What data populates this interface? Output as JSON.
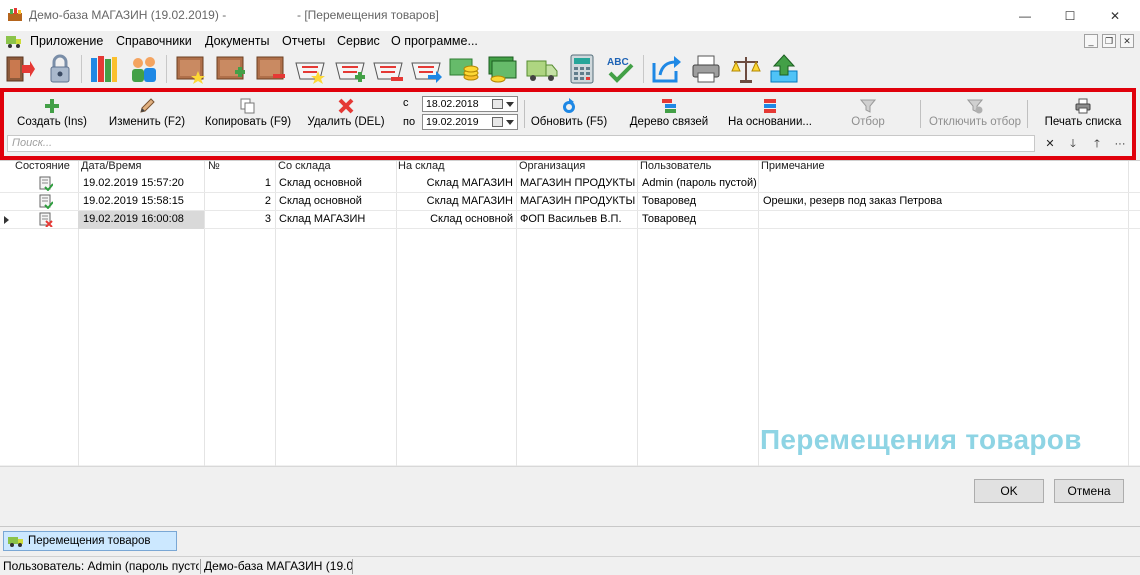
{
  "window": {
    "title_left": "Демо-база МАГАЗИН (19.02.2019) -",
    "title_right": "- [Перемещения товаров]",
    "minimize": "—",
    "maximize": "☐",
    "close": "✕"
  },
  "menu": {
    "items": [
      "Приложение",
      "Справочники",
      "Документы",
      "Отчеты",
      "Сервис",
      "О программе..."
    ],
    "mdi_minimize": "_",
    "mdi_restore": "❐",
    "mdi_close": "✕"
  },
  "commands": {
    "create": "Создать (Ins)",
    "edit": "Изменить (F2)",
    "copy": "Копировать (F9)",
    "delete": "Удалить (DEL)",
    "refresh": "Обновить (F5)",
    "tree": "Дерево связей",
    "based_on": "На основании...",
    "filter": "Отбор",
    "disable_filter": "Отключить отбор",
    "print_list": "Печать списка"
  },
  "period": {
    "from_label": "с",
    "to_label": "по",
    "from": "18.02.2018",
    "to": "19.02.2019"
  },
  "search": {
    "placeholder": "Поиск...",
    "clear": "✕",
    "next": "🡓",
    "prev": "🡑",
    "more": "···"
  },
  "table": {
    "columns": [
      "Состояние",
      "Дата/Время",
      "№",
      "Со склада",
      "На склад",
      "Организация",
      "Пользователь",
      "Примечание"
    ],
    "rows": [
      {
        "state": "posted",
        "datetime": "19.02.2019 15:57:20",
        "number": "1",
        "from": "Склад основной",
        "to": "Склад МАГАЗИН",
        "org": "МАГАЗИН ПРОДУКТЫ",
        "user": "Admin (пароль пустой)",
        "note": ""
      },
      {
        "state": "posted",
        "datetime": "19.02.2019 15:58:15",
        "number": "2",
        "from": "Склад основной",
        "to": "Склад МАГАЗИН",
        "org": "МАГАЗИН ПРОДУКТЫ",
        "user": "Товаровед",
        "note": "Орешки, резерв под заказ Петрова"
      },
      {
        "state": "not-posted",
        "datetime": "19.02.2019 16:00:08",
        "number": "3",
        "from": "Склад МАГАЗИН",
        "to": "Склад основной",
        "org": "ФОП Васильев В.П.",
        "user": "Товаровед",
        "note": ""
      }
    ]
  },
  "watermark": "Перемещения товаров",
  "buttons": {
    "ok": "OK",
    "cancel": "Отмена"
  },
  "taskbar": {
    "task": "Перемещения товаров"
  },
  "status": {
    "user": "Пользователь: Admin (пароль пусто",
    "db": "Демо-база МАГАЗИН (19.0"
  },
  "colors": {
    "highlight": "#e0000b",
    "watermark": "#8ed4e4",
    "selection": "#cce8ff"
  }
}
